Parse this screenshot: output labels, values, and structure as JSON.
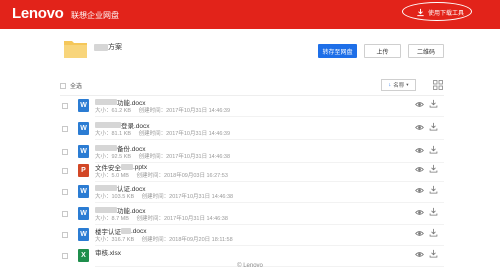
{
  "header": {
    "logo": "Lenovo",
    "subtitle": "联想企业网盘",
    "download_tool_label": "使用下载工具",
    "colors": {
      "brand": "#e2231a",
      "accent": "#1e6fe8"
    }
  },
  "share": {
    "folder_name_suffix": "方案",
    "folder_icon": "folder-icon",
    "buttons": {
      "save": "转存至网盘",
      "upload": "上传",
      "qrcode": "二维码"
    }
  },
  "toolbar": {
    "select_all": "全选",
    "sort_label": "名称",
    "sort_icon": "sort-down-arrow-icon",
    "view_icon": "grid-view-icon"
  },
  "files": [
    {
      "name_suffix": "功能.docx",
      "type": "W",
      "size": "大小：61.2 KB",
      "time": "创建时间：2017年10月31日 14:46:39"
    },
    {
      "name_suffix": "登录.docx",
      "type": "W",
      "size": "大小：81.1 KB",
      "time": "创建时间：2017年10月31日 14:46:39"
    },
    {
      "name_suffix": "备份.docx",
      "type": "W",
      "size": "大小：92.5 KB",
      "time": "创建时间：2017年10月31日 14:46:38"
    },
    {
      "name_prefix": "文件安全",
      "name_suffix": ".pptx",
      "type": "P",
      "size": "大小：5.0 MB",
      "time": "创建时间：2018年09月03日 16:27:53"
    },
    {
      "name_suffix": "认证.docx",
      "type": "W",
      "size": "大小：103.5 KB",
      "time": "创建时间：2017年10月31日 14:46:38"
    },
    {
      "name_suffix": "功能.docx",
      "type": "W",
      "size": "大小：8.7 MB",
      "time": "创建时间：2017年10月31日 14:46:38"
    },
    {
      "name_prefix": "楼宇认证",
      "name_suffix": ".docx",
      "type": "W",
      "size": "大小：316.7 KB",
      "time": "创建时间：2018年09月20日 18:11:58"
    },
    {
      "name_prefix": "审核.xlsx",
      "name_suffix": "",
      "type": "X",
      "size": "",
      "time": ""
    }
  ],
  "footer": {
    "text": "© Lenovo"
  }
}
